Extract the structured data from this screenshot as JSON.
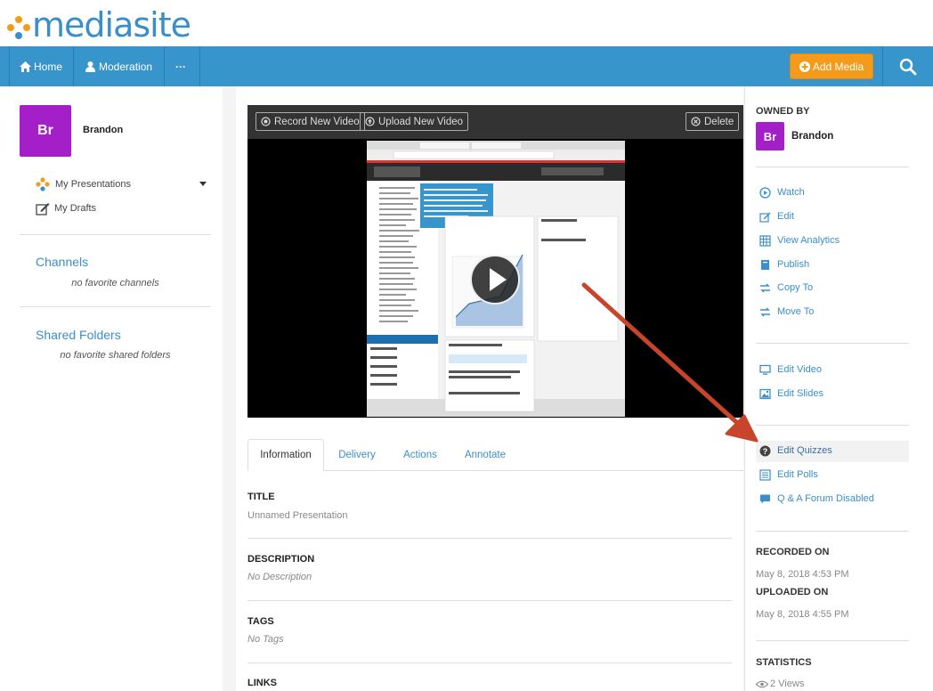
{
  "brand": {
    "name": "mediasite",
    "colors": {
      "dot_orange": "#f49b1b",
      "dot_blue": "#3a8fc9",
      "nav": "#3795cc",
      "accent": "#f49b1b",
      "avatar": "#a51fc9"
    }
  },
  "nav": {
    "home": "Home",
    "moderation": "Moderation",
    "more": "···",
    "add_media": "Add Media"
  },
  "user": {
    "initials": "Br",
    "name": "Brandon"
  },
  "sidebar": {
    "my_presentations": "My Presentations",
    "my_drafts": "My Drafts",
    "channels_title": "Channels",
    "channels_empty": "no favorite channels",
    "shared_title": "Shared Folders",
    "shared_empty": "no favorite shared folders"
  },
  "video": {
    "record_new": "Record New Video",
    "upload_new": "Upload New Video",
    "delete": "Delete"
  },
  "tabs": [
    "Information",
    "Delivery",
    "Actions",
    "Annotate"
  ],
  "info": {
    "title_label": "TITLE",
    "title_value": "Unnamed Presentation",
    "description_label": "DESCRIPTION",
    "description_value": "No Description",
    "tags_label": "TAGS",
    "tags_value": "No Tags",
    "links_label": "LINKS"
  },
  "right": {
    "owned_by": "OWNED BY",
    "owner_initials": "Br",
    "owner_name": "Brandon",
    "actions": [
      {
        "label": "Watch",
        "icon": "play-circle-icon"
      },
      {
        "label": "Edit",
        "icon": "pencil-icon"
      },
      {
        "label": "View Analytics",
        "icon": "analytics-icon"
      },
      {
        "label": "Publish",
        "icon": "publish-icon"
      },
      {
        "label": "Copy To",
        "icon": "copy-arrows-icon"
      },
      {
        "label": "Move To",
        "icon": "move-arrows-icon"
      }
    ],
    "editors": [
      {
        "label": "Edit Video",
        "icon": "monitor-icon"
      },
      {
        "label": "Edit Slides",
        "icon": "image-icon"
      }
    ],
    "extras": [
      {
        "label": "Edit Quizzes",
        "icon": "question-circle-icon"
      },
      {
        "label": "Edit Polls",
        "icon": "list-icon"
      },
      {
        "label": "Q & A Forum Disabled",
        "icon": "chat-bubble-icon"
      }
    ],
    "recorded_on_label": "RECORDED ON",
    "recorded_on": "May 8, 2018 4:53 PM",
    "uploaded_on_label": "UPLOADED ON",
    "uploaded_on": "May 8, 2018 4:55 PM",
    "statistics_label": "STATISTICS",
    "views": "2 Views"
  }
}
